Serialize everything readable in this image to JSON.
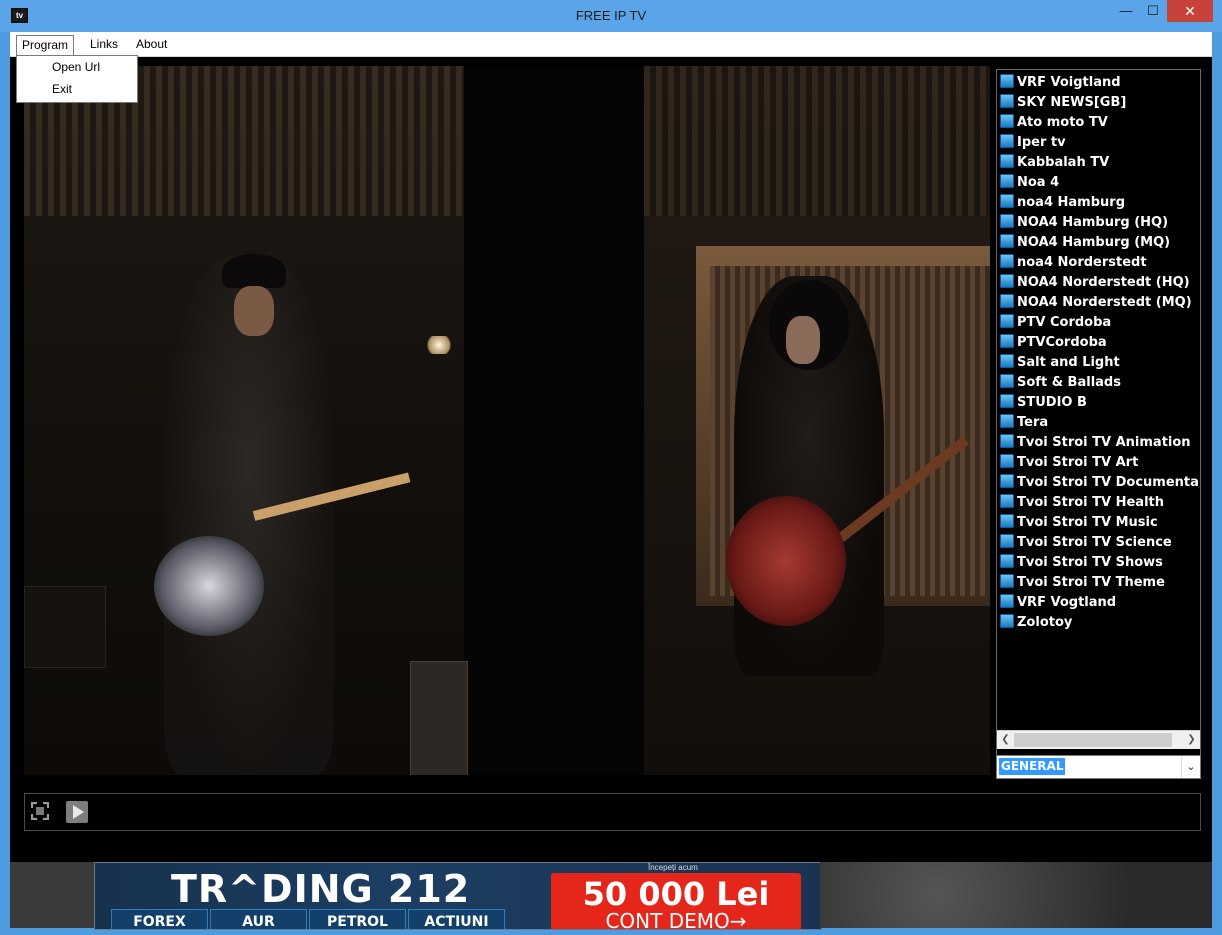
{
  "window": {
    "title": "FREE IP TV",
    "icon_label": "tv",
    "minimize_glyph": "—",
    "maximize_glyph": "☐",
    "close_glyph": "✕"
  },
  "menu": {
    "items": [
      {
        "label": "Program"
      },
      {
        "label": "Links"
      },
      {
        "label": "About"
      }
    ],
    "program_dropdown": [
      {
        "label": "Open Url"
      },
      {
        "label": "Exit"
      }
    ]
  },
  "channels": [
    "VRF Voigtland",
    "SKY NEWS[GB]",
    "Ato moto TV",
    "Iper tv",
    "Kabbalah TV",
    "Noa 4",
    "noa4 Hamburg",
    "NOA4 Hamburg (HQ)",
    "NOA4 Hamburg (MQ)",
    "noa4 Norderstedt",
    "NOA4 Norderstedt (HQ)",
    "NOA4 Norderstedt (MQ)",
    "PTV Cordoba",
    "PTVCordoba",
    "Salt and Light",
    "Soft & Ballads",
    "STUDIO B",
    "Tera",
    "Tvoi Stroi TV Animation",
    "Tvoi Stroi TV Art",
    "Tvoi Stroi TV Documentar",
    "Tvoi Stroi TV Health",
    "Tvoi Stroi TV Music",
    "Tvoi Stroi TV Science",
    "Tvoi Stroi TV Shows",
    "Tvoi Stroi TV Theme",
    "VRF Vogtland",
    "Zolotoy"
  ],
  "channel_icon": "tv-icon",
  "scrollbar": {
    "left_glyph": "❮",
    "right_glyph": "❯"
  },
  "category": {
    "value": "GENERAL",
    "arrow_glyph": "⌄"
  },
  "controls": {
    "fullscreen_icon": "fullscreen-icon",
    "play_icon": "play-icon"
  },
  "ad": {
    "brand": "TR^DING 212",
    "cta_top": "Începeți acum",
    "cta_amount": "50 000 Lei",
    "cta_sub": "CONT DEMO→",
    "tabs": [
      "FOREX",
      "AUR",
      "PETROL",
      "ACTIUNI"
    ]
  },
  "colors": {
    "titlebar": "#5aa5ea",
    "close": "#c7433a",
    "selection": "#3399ff",
    "ad_red": "#e5261a"
  }
}
